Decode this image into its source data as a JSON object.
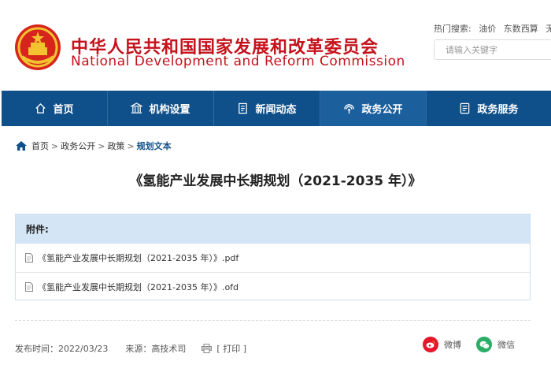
{
  "header": {
    "site_name_cn": "中华人民共和国国家发展和改革委员会",
    "site_name_en": "National Development and Reform Commission",
    "hot_label": "热门搜索:",
    "hot_keywords": [
      "油价",
      "东数西算",
      "无"
    ],
    "search_placeholder": "请输入关键字",
    "brand_color": "#c5121b"
  },
  "nav": {
    "items": [
      {
        "label": "首页",
        "icon": "home-icon"
      },
      {
        "label": "机构设置",
        "icon": "building-icon"
      },
      {
        "label": "新闻动态",
        "icon": "newspaper-icon"
      },
      {
        "label": "政务公开",
        "icon": "broadcast-icon"
      },
      {
        "label": "政务服务",
        "icon": "service-icon"
      }
    ],
    "active_index": 3,
    "bg_color": "#10508a"
  },
  "breadcrumb": {
    "items": [
      "首页",
      "政务公开",
      "政策",
      "规划文本"
    ],
    "separator": ">"
  },
  "article": {
    "title": "《氢能产业发展中长期规划（2021-2035 年）》"
  },
  "attachments": {
    "header": "附件:",
    "files": [
      "《氢能产业发展中长期规划（2021-2035 年）》.pdf",
      "《氢能产业发展中长期规划（2021-2035 年）》.ofd"
    ]
  },
  "meta": {
    "publish_label": "发布时间：2022/03/23",
    "source_label": "来源：高技术司",
    "print_label": "[ 打印 ]"
  },
  "share": {
    "weibo_label": "微博",
    "wechat_label": "微信",
    "weibo_color": "#e6162d",
    "wechat_color": "#2aae67"
  }
}
